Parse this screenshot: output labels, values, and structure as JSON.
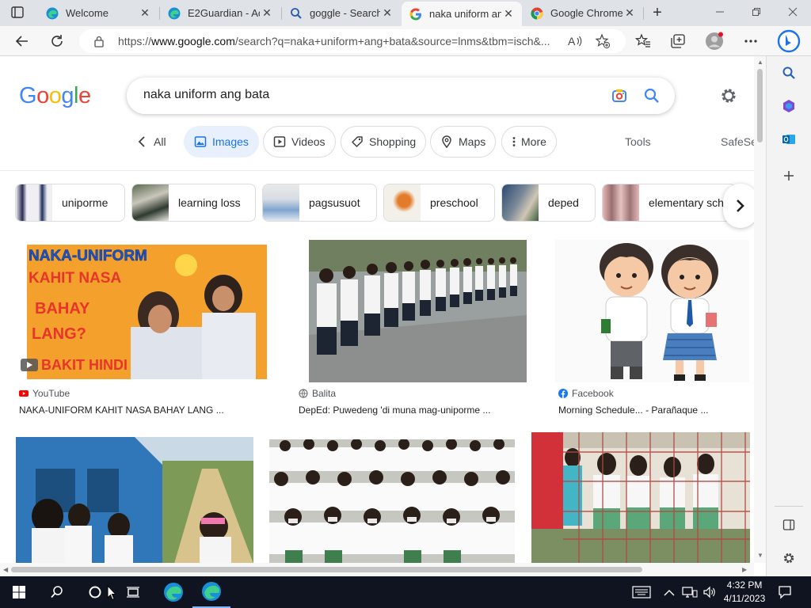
{
  "browser": {
    "tabs": [
      {
        "title": "Welcome",
        "icon": "edge-icon",
        "close": "✕"
      },
      {
        "title": "E2Guardian - Ac",
        "icon": "edge-icon",
        "close": "✕"
      },
      {
        "title": "goggle - Search",
        "icon": "search-icon",
        "close": "✕"
      },
      {
        "title": "naka uniform an",
        "icon": "google-icon",
        "close": "✕",
        "active": true
      },
      {
        "title": "Google Chrome",
        "icon": "chrome-icon",
        "close": "✕"
      }
    ],
    "new_tab": "+",
    "address": {
      "prefix": "https://",
      "domain": "www.google.com",
      "path": "/search?q=naka+uniform+ang+bata&source=lnms&tbm=isch&..."
    }
  },
  "google": {
    "logo": [
      "G",
      "o",
      "o",
      "g",
      "l",
      "e"
    ],
    "logo_colors": [
      "#4285F4",
      "#EA4335",
      "#FBBC05",
      "#4285F4",
      "#34A853",
      "#EA4335"
    ],
    "query": "naka uniform ang bata",
    "nav": {
      "all": "All",
      "images": "Images",
      "videos": "Videos",
      "shopping": "Shopping",
      "maps": "Maps",
      "more": "More",
      "tools": "Tools",
      "safesearch": "SafeSe"
    },
    "related": [
      {
        "label": "uniporme",
        "thumb": "#c9c2d0"
      },
      {
        "label": "learning loss",
        "thumb": "#8a8f7a"
      },
      {
        "label": "pagsusuot",
        "thumb": "#c7d0da"
      },
      {
        "label": "preschool",
        "thumb": "#d98a3a"
      },
      {
        "label": "deped",
        "thumb": "#5a6b7a"
      },
      {
        "label": "elementary sch",
        "thumb": "#b89a8a"
      }
    ],
    "results": [
      {
        "source": "YouTube",
        "title": "NAKA-UNIFORM KAHIT NASA BAHAY LANG ...",
        "img_text": [
          "NAKA-UNIFORM",
          "KAHIT NASA",
          "BAHAY",
          "LANG?",
          "BAKIT HINDI"
        ]
      },
      {
        "source": "Balita",
        "title": "DepEd: Puwedeng 'di muna mag-uniporme ..."
      },
      {
        "source": "Facebook",
        "title": "Morning Schedule... - Parañaque ..."
      },
      {
        "source": "",
        "title": ""
      },
      {
        "source": "",
        "title": ""
      },
      {
        "source": "",
        "title": ""
      }
    ]
  },
  "taskbar": {
    "time": "4:32 PM",
    "date": "4/11/2023"
  }
}
